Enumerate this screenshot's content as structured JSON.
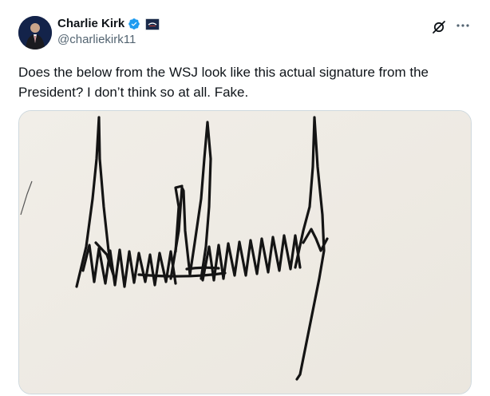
{
  "author": {
    "display_name": "Charlie Kirk",
    "handle": "@charliekirk11"
  },
  "icons": {
    "verified": "verified-badge-icon",
    "affiliation": "affiliation-badge-icon",
    "grok": "grok-icon",
    "more": "more-options-icon"
  },
  "colors": {
    "verified_blue": "#1d9bf0",
    "text_primary": "#0f1419",
    "text_secondary": "#536471",
    "paper": "#efece6"
  },
  "tweet": {
    "text": "Does the below from the WSJ look like this actual signature from the President? I don’t think so at all. Fake."
  },
  "media": {
    "kind": "photo-of-handwritten-signature"
  }
}
